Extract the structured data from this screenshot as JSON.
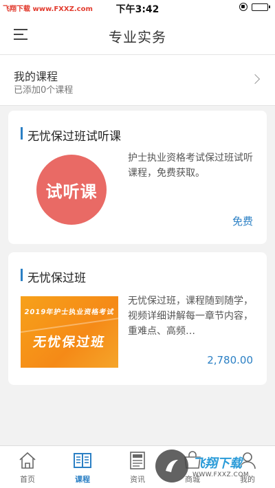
{
  "status": {
    "carrier": "飞翔下载 www.FXXZ.com",
    "time": "下午3:42"
  },
  "header": {
    "title": "专业实务"
  },
  "my_courses": {
    "title": "我的课程",
    "subtitle": "已添加0个课程"
  },
  "courses": [
    {
      "title": "无忧保过班试听课",
      "thumb_text": "试听课",
      "description": "护士执业资格考试保过班试听课程，免费获取。",
      "price": "免费"
    },
    {
      "title": "无忧保过班",
      "thumb_line1": "2019年护士执业资格考试",
      "thumb_line2": "无忧保过班",
      "description": "无忧保过班，课程随到随学，视频详细讲解每一章节内容，重难点、高频…",
      "price": "2,780.00"
    }
  ],
  "tabs": [
    {
      "label": "首页",
      "icon": "home-icon"
    },
    {
      "label": "课程",
      "icon": "book-icon",
      "active": true
    },
    {
      "label": "资讯",
      "icon": "news-icon"
    },
    {
      "label": "商城",
      "icon": "shop-icon"
    },
    {
      "label": "我的",
      "icon": "profile-icon"
    }
  ],
  "watermark": {
    "main": "飞翔下载",
    "url": "WWW.FXXZ.COM"
  },
  "colors": {
    "accent": "#2a7fc4",
    "trial_circle": "#e96a65",
    "thumb_orange": "#f58a17"
  }
}
